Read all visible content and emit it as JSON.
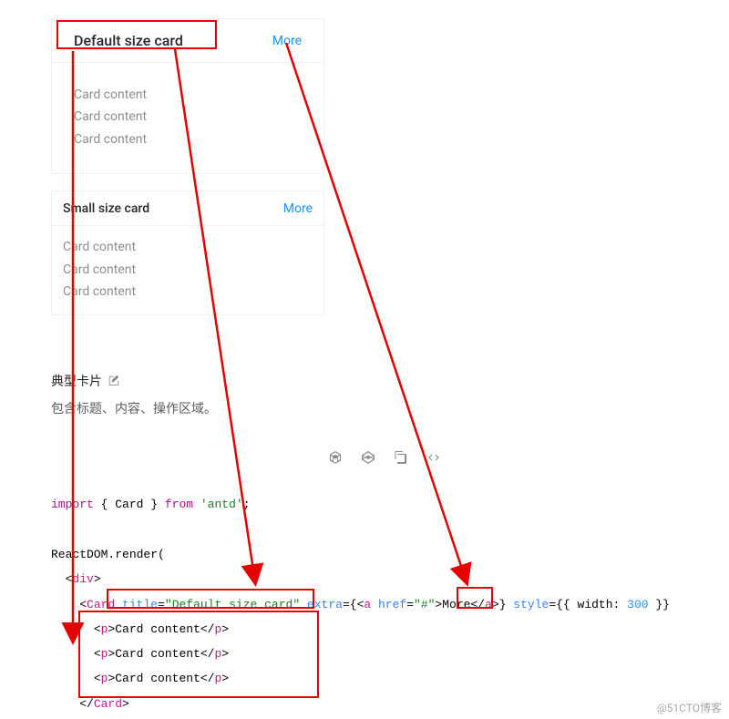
{
  "card1": {
    "title": "Default size card",
    "more_label": "More",
    "body": [
      "Card content",
      "Card content",
      "Card content"
    ]
  },
  "card2": {
    "title": "Small size card",
    "more_label": "More",
    "body": [
      "Card content",
      "Card content",
      "Card content"
    ]
  },
  "section": {
    "title": "典型卡片",
    "desc": "包含标题、内容、操作区域。"
  },
  "code": {
    "line1_import": "import",
    "line1_brace_l": " { ",
    "line1_Card": "Card",
    "line1_brace_r": " } ",
    "line1_from": "from",
    "line1_pkg": "'antd'",
    "line1_semi": ";",
    "line3_react": "ReactDOM",
    "line3_render": ".render(",
    "line4_lt": "<",
    "line4_div": "div",
    "line4_gt": ">",
    "line5_lt": "<",
    "line5_Card": "Card",
    "line5_title_attr": "title",
    "line5_eq": "=",
    "line5_title_val": "\"Default size card\"",
    "line5_extra_attr": " extra",
    "line5_extra_eq": "=",
    "line5_extra_brace": "{",
    "line5_a_lt": "<",
    "line5_a": "a",
    "line5_href_attr": " href",
    "line5_href_eq": "=",
    "line5_href_val": "\"#\"",
    "line5_a_gt": ">",
    "line5_more": "More",
    "line5_a_close": "</",
    "line5_a2": "a",
    "line5_a_close_gt": ">",
    "line5_brace_r": "}",
    "line5_style_attr": " style",
    "line5_style_eq": "=",
    "line5_style_val": "{{ width: ",
    "line5_width_num": "300",
    "line5_style_end": " }}",
    "line5_gt": ":",
    "line6_popen": "<",
    "line6_p": "p",
    "line6_pgt": ">",
    "line6_text": "Card content",
    "line6_pclose": "</",
    "line6_p2": "p",
    "line6_pcgt": ">",
    "line7_text": "Card content",
    "line8_text": "Card content",
    "line9_close": "</",
    "line9_Card": "Card",
    "line9_gt": ">"
  },
  "watermark": "@51CTO博客"
}
